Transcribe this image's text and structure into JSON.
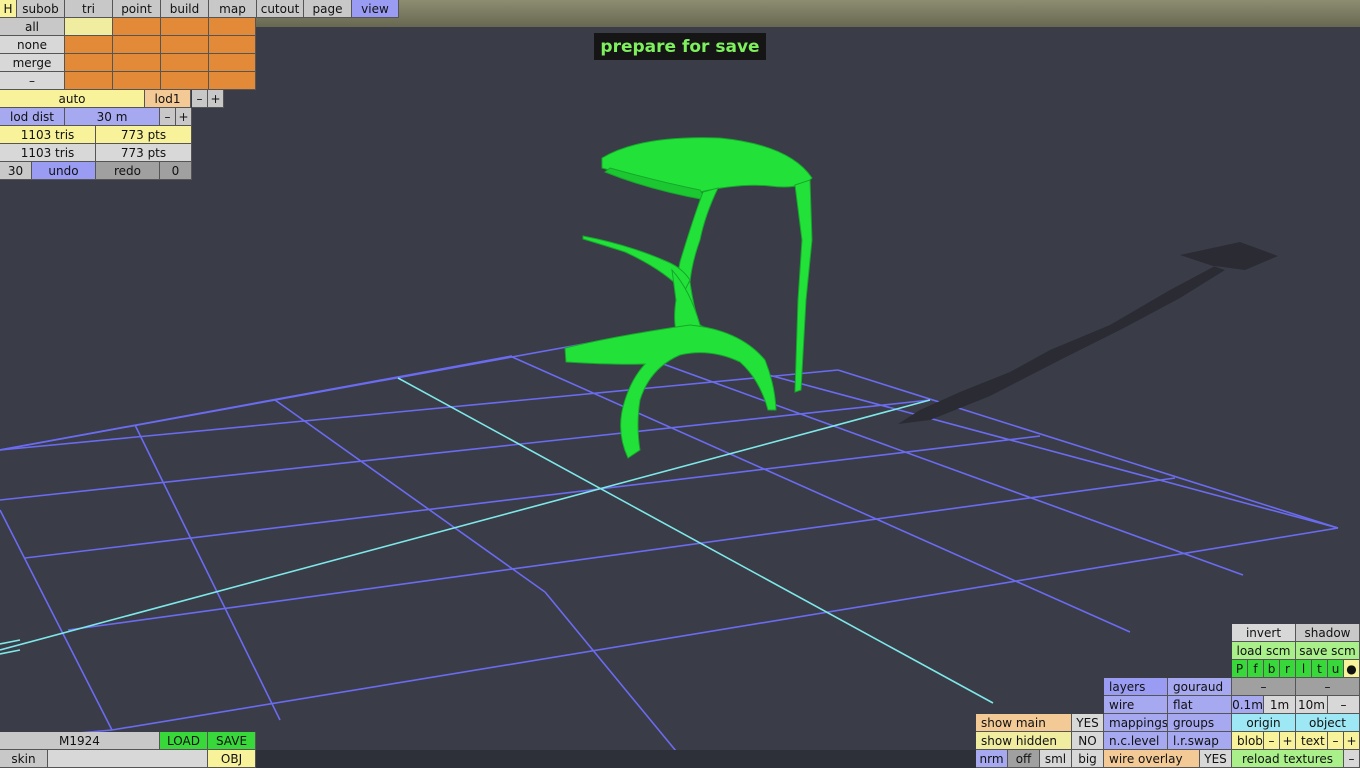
{
  "menu": {
    "h": "H",
    "tabs": [
      "subob",
      "tri",
      "point",
      "build",
      "map",
      "cutout",
      "page",
      "view"
    ]
  },
  "select_panel": {
    "rows": [
      "all",
      "none",
      "merge",
      "–"
    ]
  },
  "lod": {
    "auto": "auto",
    "lod_name": "lod1",
    "minus": "–",
    "plus": "+",
    "dist_label": "lod dist",
    "dist_value": "30 m"
  },
  "stats": {
    "row1_tris": "1103 tris",
    "row1_pts": "773 pts",
    "row2_tris": "1103 tris",
    "row2_pts": "773 pts"
  },
  "history": {
    "count": "30",
    "undo": "undo",
    "redo": "redo",
    "redo_count": "0"
  },
  "banner": {
    "text": "prepare for save"
  },
  "file": {
    "name": "M1924",
    "load": "LOAD",
    "save": "SAVE",
    "skin": "skin",
    "obj": "OBJ"
  },
  "show": {
    "main_label": "show main",
    "main_value": "YES",
    "hidden_label": "show hidden",
    "hidden_value": "NO",
    "nrm": "nrm",
    "off": "off",
    "sml": "sml",
    "big": "big"
  },
  "render": {
    "layers": "layers",
    "gouraud": "gouraud",
    "wire": "wire",
    "flat": "flat",
    "mappings": "mappings",
    "groups": "groups",
    "nc_level": "n.c.level",
    "lr_swap": "l.r.swap",
    "wire_overlay": "wire overlay",
    "wire_overlay_value": "YES"
  },
  "right_panel": {
    "invert": "invert",
    "shadow": "shadow",
    "load_scm": "load scm",
    "save_scm": "save scm",
    "letters": [
      "P",
      "f",
      "b",
      "r",
      "l",
      "t",
      "u",
      "●"
    ],
    "dash1": "–",
    "dash2": "–",
    "d01": "0.1m",
    "d1": "1m",
    "d10": "10m",
    "dminus": "–",
    "origin": "origin",
    "object": "object",
    "blob": "blob",
    "blob_minus": "–",
    "blob_plus": "+",
    "text": "text",
    "text_minus": "–",
    "text_plus": "+",
    "reload": "reload textures",
    "reload_minus": "–"
  },
  "colors": {
    "background": "#3a3c48",
    "grid": "#6b6bf0",
    "axis": "#7ee8e8",
    "model": "#22e23a",
    "banner_text": "#7ef05e"
  }
}
